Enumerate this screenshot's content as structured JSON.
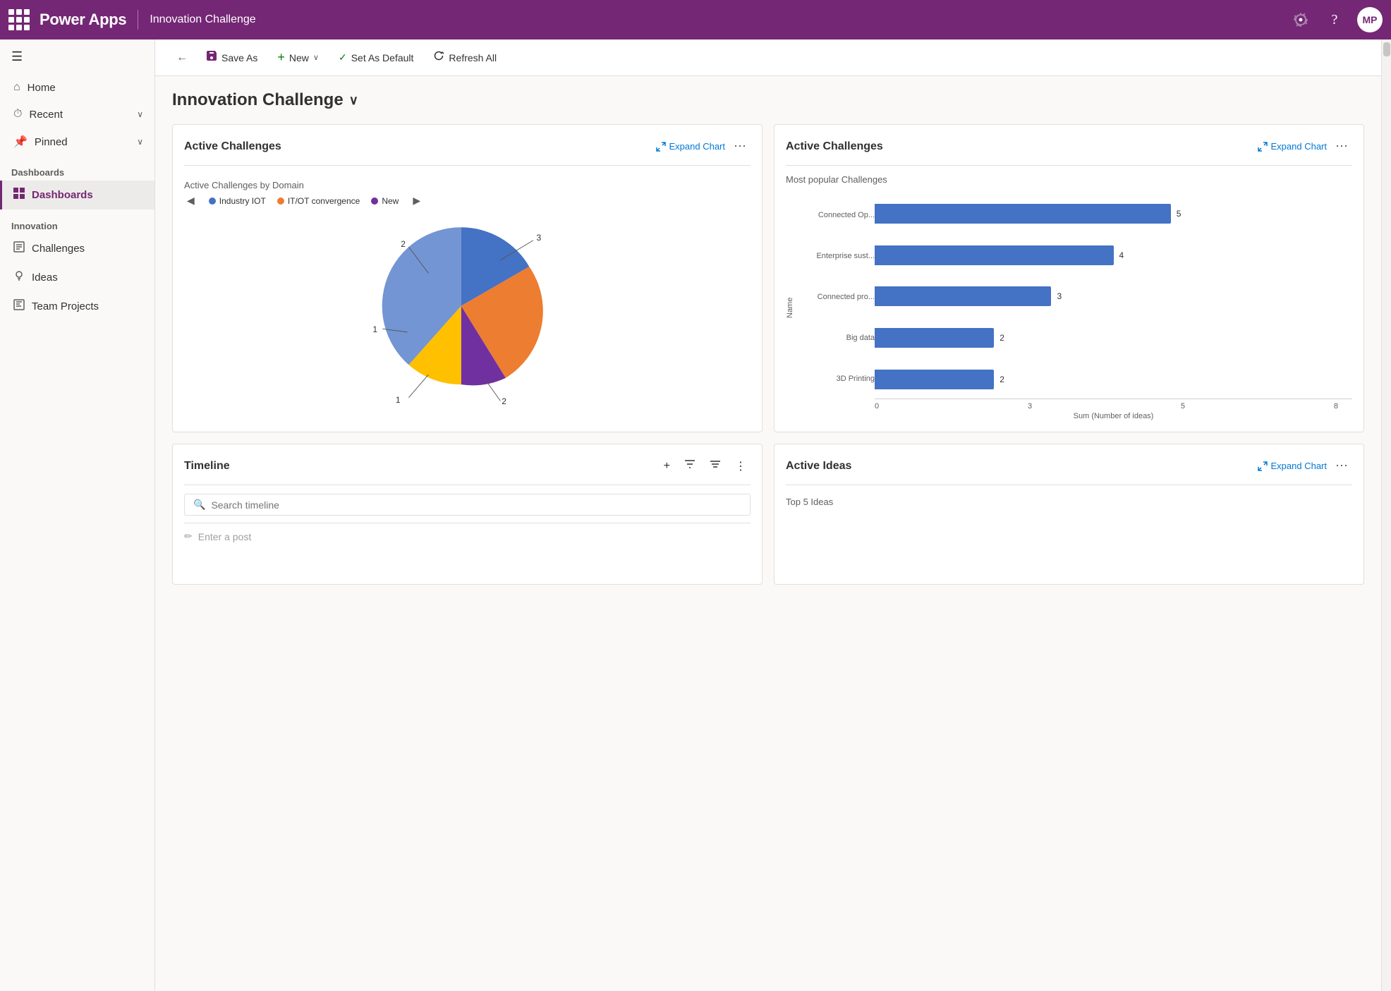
{
  "app": {
    "name": "Power Apps",
    "divider": "|",
    "page_name": "Innovation Challenge"
  },
  "nav_icons": {
    "gear": "⚙",
    "help": "?",
    "avatar": "MP",
    "grid": "⊞"
  },
  "toolbar": {
    "back_label": "←",
    "save_as_label": "Save As",
    "new_label": "New",
    "new_chevron": "∨",
    "set_default_label": "Set As Default",
    "refresh_label": "Refresh All"
  },
  "page_title": "Innovation Challenge",
  "page_title_chevron": "∨",
  "sidebar": {
    "menu_icon": "≡",
    "items": [
      {
        "id": "home",
        "label": "Home",
        "icon": "⌂",
        "active": false
      },
      {
        "id": "recent",
        "label": "Recent",
        "icon": "⏱",
        "active": false,
        "has_chevron": true
      },
      {
        "id": "pinned",
        "label": "Pinned",
        "icon": "📌",
        "active": false,
        "has_chevron": true
      }
    ],
    "section_dashboards": "Dashboards",
    "dashboards_items": [
      {
        "id": "dashboards",
        "label": "Dashboards",
        "icon": "📊",
        "active": true
      }
    ],
    "section_innovation": "Innovation",
    "innovation_items": [
      {
        "id": "challenges",
        "label": "Challenges",
        "icon": "📋",
        "active": false
      },
      {
        "id": "ideas",
        "label": "Ideas",
        "icon": "💡",
        "active": false
      },
      {
        "id": "team-projects",
        "label": "Team Projects",
        "icon": "📦",
        "active": false
      }
    ]
  },
  "chart1": {
    "title": "Active Challenges",
    "expand_label": "Expand Chart",
    "subtitle": "Active Challenges by Domain",
    "legend": [
      {
        "label": "Industry IOT",
        "color": "#4472c4"
      },
      {
        "label": "IT/OT convergence",
        "color": "#ed7d31"
      },
      {
        "label": "New",
        "color": "#7030a0"
      }
    ],
    "segments": [
      {
        "label": "3",
        "value": 3,
        "color": "#4472c4",
        "startAngle": 0,
        "endAngle": 120
      },
      {
        "label": "2",
        "value": 2,
        "color": "#ed7d31",
        "startAngle": 120,
        "endAngle": 200
      },
      {
        "label": "1",
        "value": 1,
        "color": "#7030a0",
        "startAngle": 200,
        "endAngle": 245
      },
      {
        "label": "1",
        "value": 1,
        "color": "#ffc000",
        "startAngle": 245,
        "endAngle": 295
      },
      {
        "label": "2",
        "value": 2,
        "color": "#4472c4",
        "startAngle": 295,
        "endAngle": 360
      }
    ]
  },
  "chart2": {
    "title": "Active Challenges",
    "expand_label": "Expand Chart",
    "subtitle": "Most popular Challenges",
    "y_axis_label": "Name",
    "x_axis_label": "Sum (Number of ideas)",
    "x_ticks": [
      "0",
      "3",
      "5",
      "8"
    ],
    "bars": [
      {
        "label": "Connected Op...",
        "value": 5,
        "pct": 62
      },
      {
        "label": "Enterprise sust...",
        "value": 4,
        "pct": 50
      },
      {
        "label": "Connected pro...",
        "value": 3,
        "pct": 37
      },
      {
        "label": "Big data",
        "value": 2,
        "pct": 25
      },
      {
        "label": "3D Printing",
        "value": 2,
        "pct": 25
      }
    ]
  },
  "timeline": {
    "title": "Timeline",
    "search_placeholder": "Search timeline",
    "post_placeholder": "Enter a post",
    "icons": {
      "add": "+",
      "filter": "⊘",
      "sort": "≡",
      "more": "⋮",
      "search": "🔍",
      "pencil": "✏"
    }
  },
  "chart3": {
    "title": "Active Ideas",
    "expand_label": "Expand Chart",
    "subtitle": "Top 5 Ideas"
  }
}
